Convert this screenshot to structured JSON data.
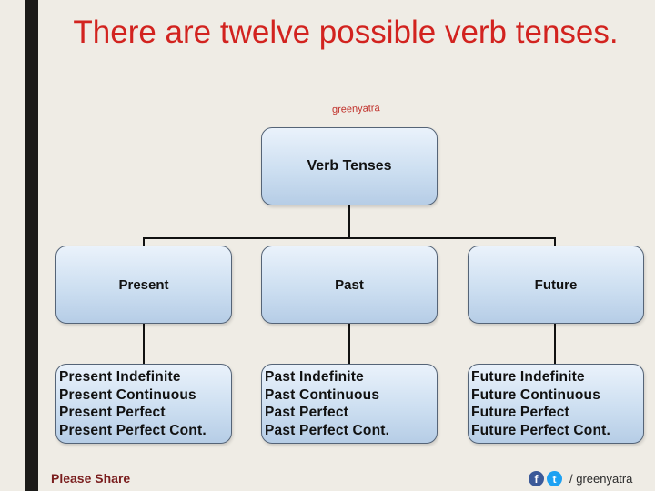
{
  "title": "There are twelve possible verb tenses.",
  "watermark": "greenyatra",
  "root": {
    "label": "Verb Tenses"
  },
  "categories": [
    {
      "label": "Present",
      "items": [
        "Present Indefinite",
        "Present Continuous",
        "Present Perfect",
        "Present Perfect Cont."
      ]
    },
    {
      "label": "Past",
      "items": [
        "Past Indefinite",
        "Past Continuous",
        "Past Perfect",
        "Past Perfect Cont."
      ]
    },
    {
      "label": "Future",
      "items": [
        "Future Indefinite",
        "Future Continuous",
        "Future Perfect",
        "Future Perfect Cont."
      ]
    }
  ],
  "footer": {
    "share_label": "Please Share",
    "facebook_glyph": "f",
    "twitter_glyph": "t",
    "handle": "/ greenyatra"
  },
  "colors": {
    "title": "#d2231f",
    "box_top": "#eaf2fb",
    "box_bottom": "#b6cde6",
    "box_border": "#556477",
    "background": "#efece5",
    "left_bar": "#1c1b19"
  }
}
